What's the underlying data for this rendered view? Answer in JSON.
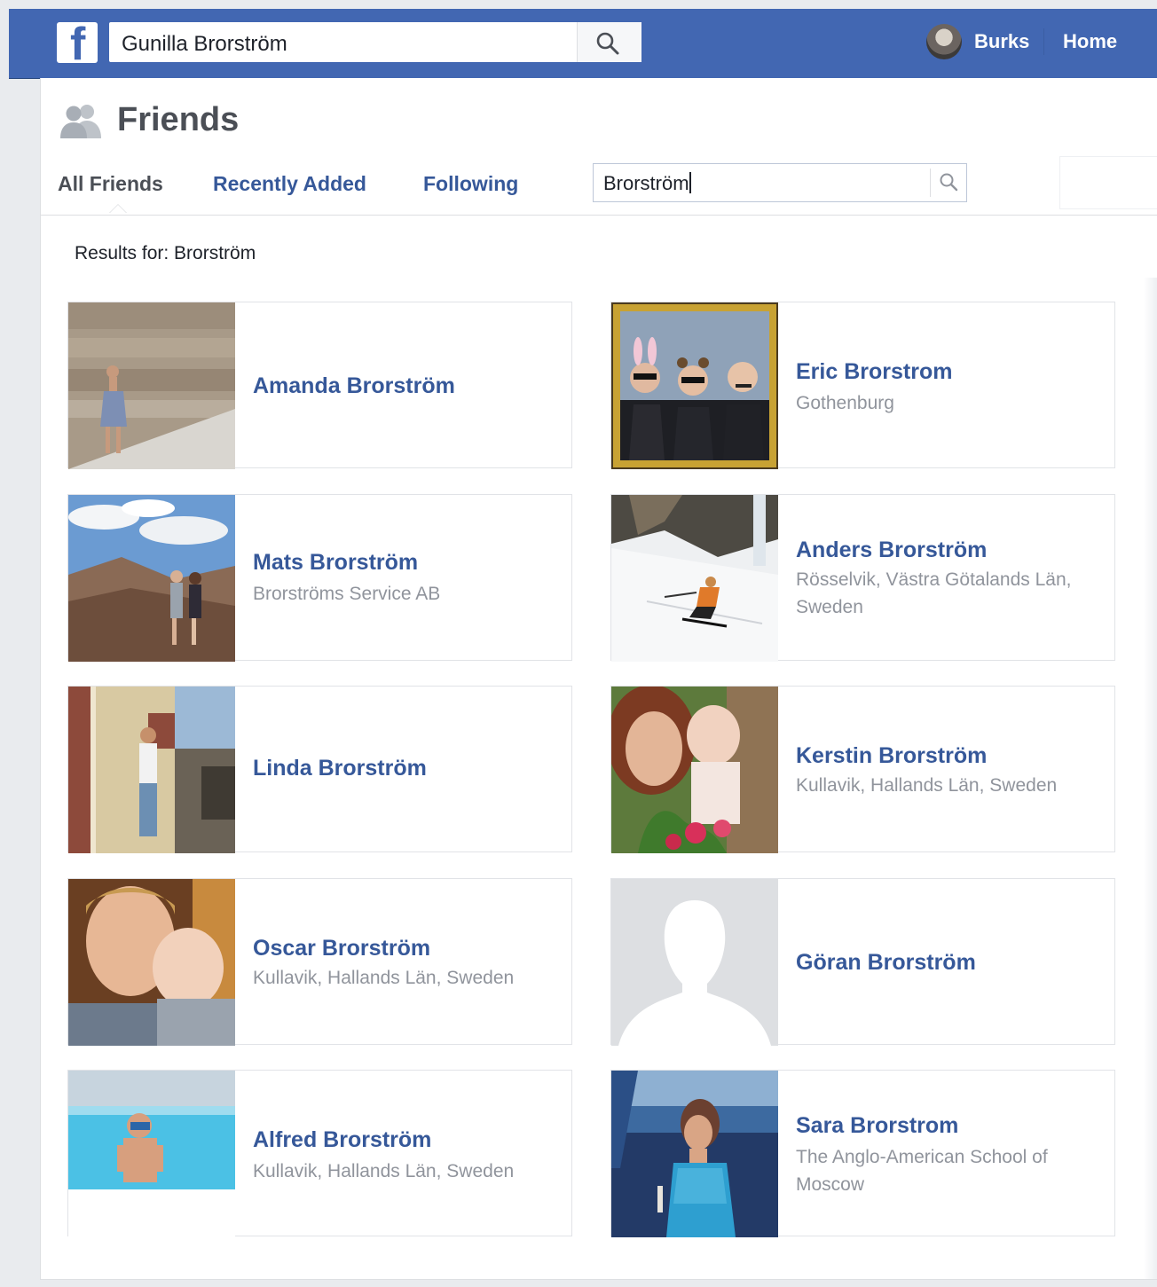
{
  "topbar": {
    "logo": "f",
    "search_value": "Gunilla Brorström",
    "user_name": "Burks",
    "home_label": "Home",
    "icons": [
      "facebook-logo",
      "search-icon",
      "avatar"
    ]
  },
  "friends": {
    "title": "Friends",
    "tabs": [
      {
        "label": "All Friends"
      },
      {
        "label": "Recently Added"
      },
      {
        "label": "Following"
      }
    ],
    "search_value": "Brorström",
    "results_label": "Results for: Brorström",
    "list": [
      {
        "name": "Amanda Brorström",
        "detail": ""
      },
      {
        "name": "Eric Brorstrom",
        "detail": "Gothenburg"
      },
      {
        "name": "Mats Brorström",
        "detail": "Brorströms Service AB"
      },
      {
        "name": "Anders Brorström",
        "detail": "Rösselvik, Västra Götalands Län, Sweden"
      },
      {
        "name": "Linda Brorström",
        "detail": ""
      },
      {
        "name": "Kerstin Brorström",
        "detail": "Kullavik, Hallands Län, Sweden"
      },
      {
        "name": "Oscar Brorström",
        "detail": "Kullavik, Hallands Län, Sweden"
      },
      {
        "name": "Göran Brorström",
        "detail": ""
      },
      {
        "name": "Alfred Brorström",
        "detail": "Kullavik, Hallands Län, Sweden"
      },
      {
        "name": "Sara Brorstrom",
        "detail": "The Anglo-American School of Moscow"
      }
    ]
  },
  "colors": {
    "brand_blue": "#4267b2",
    "link_blue": "#365899",
    "secondary_text": "#90949c"
  }
}
